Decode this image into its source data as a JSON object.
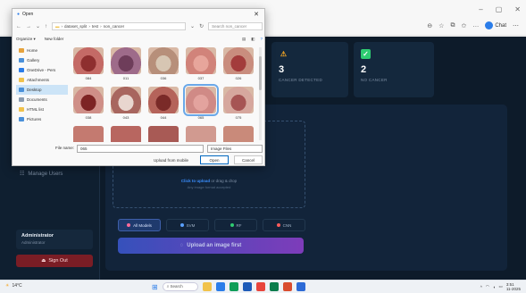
{
  "dialog": {
    "title": "Open",
    "path": [
      "dataset_split",
      "test",
      "non_cancer"
    ],
    "search_placeholder": "Search non_cancer",
    "organize_label": "Organize",
    "new_folder_label": "New folder",
    "nav_items": [
      {
        "label": "Home",
        "color": "#e6a23c"
      },
      {
        "label": "Gallery",
        "color": "#4a90d9"
      },
      {
        "label": "OneDrive - Pers",
        "color": "#2b7de9"
      },
      {
        "label": "Attachments",
        "color": "#f1c24b"
      },
      {
        "label": "Desktop",
        "color": "#4a90d9"
      },
      {
        "label": "Documents",
        "color": "#8a9bb0"
      },
      {
        "label": "HTML list",
        "color": "#f1c24b"
      },
      {
        "label": "Pictures",
        "color": "#4a90d9"
      }
    ],
    "thumbnails": [
      {
        "label": "084",
        "color": "#c46a66",
        "inner": "#8e2f2f"
      },
      {
        "label": "011",
        "color": "#9e6b8a",
        "inner": "#6e3d5a"
      },
      {
        "label": "036",
        "color": "#b78f7a",
        "inner": "#d7c6b3"
      },
      {
        "label": "037",
        "color": "#d1837a",
        "inner": "#e7a59b"
      },
      {
        "label": "026",
        "color": "#c98d7e",
        "inner": "#a33c3c"
      },
      {
        "label": "038",
        "color": "#cf8f88",
        "inner": "#7d2424"
      },
      {
        "label": "043",
        "color": "#a8665f",
        "inner": "#e8d6cf"
      },
      {
        "label": "044",
        "color": "#b5635a",
        "inner": "#7a2a28"
      },
      {
        "label": "065",
        "color": "#d08a86",
        "inner": "#e3a39e"
      },
      {
        "label": "075",
        "color": "#d6a79e",
        "inner": "#a65454"
      }
    ],
    "file_name_label": "File name:",
    "file_name_value": "065",
    "file_type": "Image Files",
    "mobile_label": "Upload from mobile",
    "open_label": "Open",
    "cancel_label": "Cancel"
  },
  "stats": [
    {
      "value": "3",
      "label": "CANCER DETECTED",
      "icon": "warning-icon",
      "color": "#f5a623"
    },
    {
      "value": "2",
      "label": "NO CANCER",
      "icon": "check-icon",
      "color": "#2ecc71"
    }
  ],
  "sidebar": {
    "manage_users": "Manage Users",
    "admin_name": "Administrator",
    "admin_role": "Administrator",
    "signout": "Sign Out"
  },
  "upload": {
    "click_text": "Click to upload",
    "drag_text": " or drag & drop",
    "hint": "Any image format accepted",
    "models": [
      {
        "label": "All Models",
        "color": "#ff6b9a",
        "active": true
      },
      {
        "label": "SVM",
        "color": "#5aa0ff",
        "active": false
      },
      {
        "label": "RF",
        "color": "#2ecc71",
        "active": false
      },
      {
        "label": "CNN",
        "color": "#ff5b5b",
        "active": false
      }
    ],
    "button_label": "Upload an image first"
  },
  "taskbar": {
    "weather": "14°C",
    "search": "Search",
    "time": "3:51",
    "date": "11-2025"
  },
  "browser": {
    "chat_label": "Chat"
  }
}
